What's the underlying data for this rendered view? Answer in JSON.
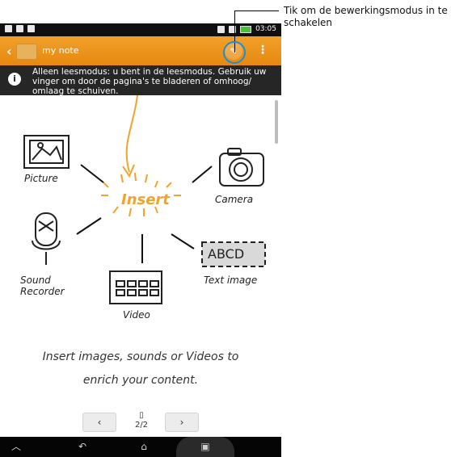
{
  "statusbar": {
    "time": "03:05"
  },
  "actionbar": {
    "title": "my note",
    "back_icon": "chevron-left-icon",
    "edit_icon": "pen-edit-icon",
    "overflow_icon": "more-vert-icon"
  },
  "notice": {
    "text": "Alleen leesmodus: u bent in de leesmodus. Gebruik uw vinger om door de pagina's te bladeren of omhoog/ omlaag te schuiven."
  },
  "illustration": {
    "center": "Insert",
    "items": [
      "Picture",
      "Camera",
      "Sound Recorder",
      "Video",
      "Text image"
    ],
    "ocr_text": "ABCD"
  },
  "caption": {
    "line1": "Insert images, sounds or Videos to",
    "line2": "enrich your content."
  },
  "pager": {
    "prev": "‹",
    "next": "›",
    "page": "2/2"
  },
  "callout": {
    "text": "Tik om de bewerkingsmodus in te schakelen"
  },
  "colors": {
    "accent": "#ef9a1e",
    "callout_circle": "#1b8fd6"
  }
}
